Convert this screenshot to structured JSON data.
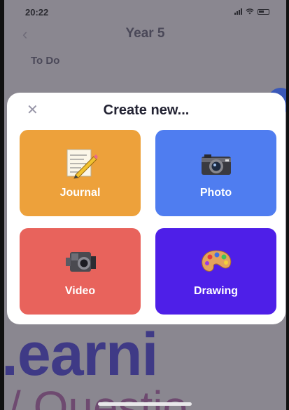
{
  "status_bar": {
    "time": "20:22"
  },
  "nav": {
    "back_icon": "chevron-left-icon",
    "title": "Year 5"
  },
  "page": {
    "section_label": "To Do",
    "bg_text_1": ".earni",
    "bg_text_2": "/ Questio"
  },
  "modal": {
    "close_icon": "close-icon",
    "title": "Create new...",
    "tiles": [
      {
        "label": "Journal",
        "icon": "notepad-pencil-icon",
        "color": "#eda13b"
      },
      {
        "label": "Photo",
        "icon": "camera-icon",
        "color": "#4f7df0"
      },
      {
        "label": "Video",
        "icon": "video-camera-icon",
        "color": "#e8635c"
      },
      {
        "label": "Drawing",
        "icon": "palette-icon",
        "color": "#4e1fe8"
      }
    ]
  }
}
